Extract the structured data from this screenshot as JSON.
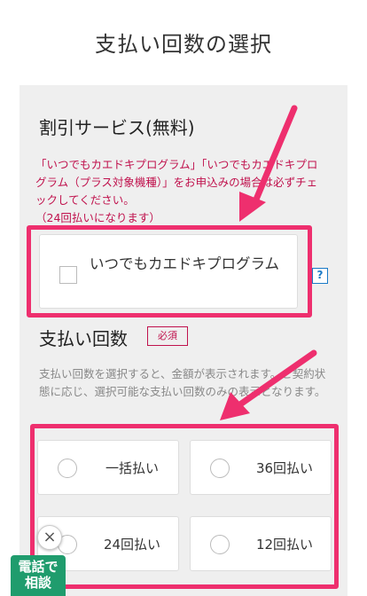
{
  "page": {
    "title": "支払い回数の選択"
  },
  "discount": {
    "title": "割引サービス(無料)",
    "notice": "「いつでもカエドキプログラム」「いつでもカエドキプログラム（プラス対象機種）」をお申込みの場合は必ずチェックしてください。",
    "notice_sub": "（24回払いになります）",
    "checkbox_label": "いつでもカエドキプログラム",
    "help": "?"
  },
  "payment": {
    "title": "支払い回数",
    "required_badge": "必須",
    "description": "支払い回数を選択すると、金額が表示されます。ご契約状態に応じ、選択可能な支払い回数のみの表示となります。",
    "options": [
      {
        "label": "一括払い"
      },
      {
        "label": "36回払い"
      },
      {
        "label": "24回払い"
      },
      {
        "label": "12回払い"
      }
    ]
  },
  "floating": {
    "close": "×",
    "call_line1": "電話で",
    "call_line2": "相談"
  },
  "colors": {
    "highlight": "#ee2f6e",
    "notice_text": "#c0124d",
    "call_button": "#1f9c6d",
    "help_icon": "#1a7ac7"
  }
}
